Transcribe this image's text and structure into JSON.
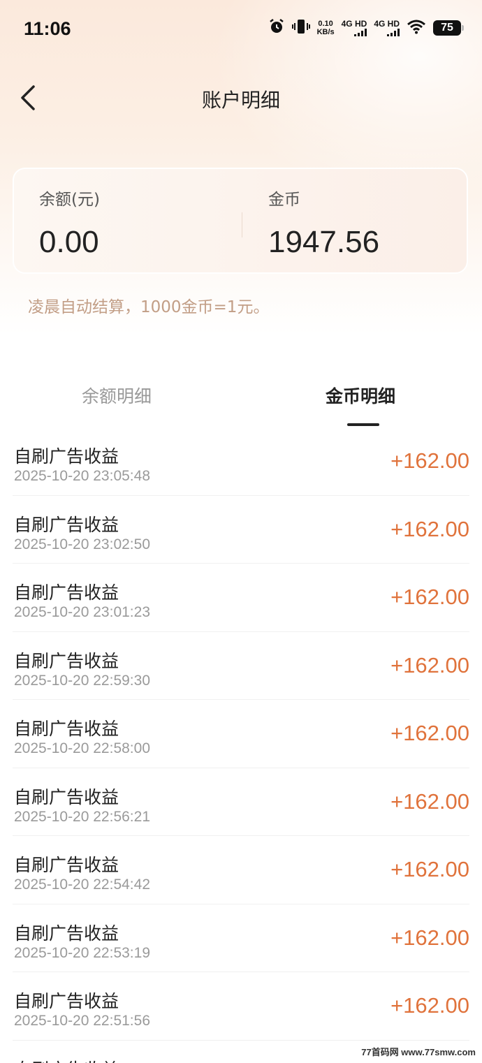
{
  "status_bar": {
    "time": "11:06",
    "net_speed_value": "0.10",
    "net_speed_unit": "KB/s",
    "signal_1": "4G HD",
    "signal_2": "4G HD",
    "battery": "75"
  },
  "nav": {
    "title": "账户明细"
  },
  "balance_card": {
    "balance_label": "余额(元)",
    "balance_value": "0.00",
    "coins_label": "金币",
    "coins_value": "1947.56"
  },
  "settle_note": "凌晨自动结算，1000金币=1元。",
  "tabs": [
    {
      "label": "余额明细",
      "active": false
    },
    {
      "label": "金币明细",
      "active": true
    }
  ],
  "records": [
    {
      "title": "自刷广告收益",
      "time": "2025-10-20 23:05:48",
      "amount": "+162.00"
    },
    {
      "title": "自刷广告收益",
      "time": "2025-10-20 23:02:50",
      "amount": "+162.00"
    },
    {
      "title": "自刷广告收益",
      "time": "2025-10-20 23:01:23",
      "amount": "+162.00"
    },
    {
      "title": "自刷广告收益",
      "time": "2025-10-20 22:59:30",
      "amount": "+162.00"
    },
    {
      "title": "自刷广告收益",
      "time": "2025-10-20 22:58:00",
      "amount": "+162.00"
    },
    {
      "title": "自刷广告收益",
      "time": "2025-10-20 22:56:21",
      "amount": "+162.00"
    },
    {
      "title": "自刷广告收益",
      "time": "2025-10-20 22:54:42",
      "amount": "+162.00"
    },
    {
      "title": "自刷广告收益",
      "time": "2025-10-20 22:53:19",
      "amount": "+162.00"
    },
    {
      "title": "自刷广告收益",
      "time": "2025-10-20 22:51:56",
      "amount": "+162.00"
    },
    {
      "title": "自刷广告收益",
      "time": "",
      "amount": ""
    }
  ],
  "watermark": "77首码网 www.77smw.com",
  "colors": {
    "accent_amount": "#e0733c",
    "note": "#c29e86"
  }
}
